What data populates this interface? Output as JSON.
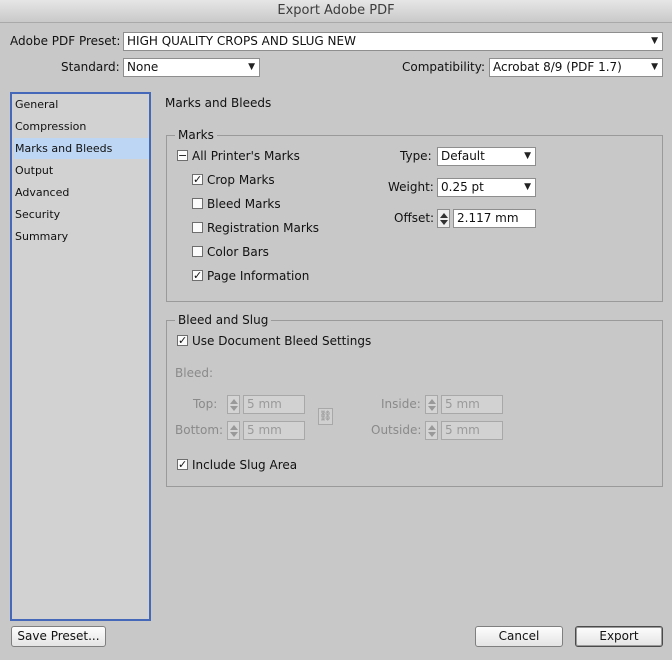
{
  "window": {
    "title": "Export Adobe PDF"
  },
  "header": {
    "preset_label": "Adobe PDF Preset:",
    "preset_value": "HIGH QUALITY CROPS AND SLUG NEW",
    "standard_label": "Standard:",
    "standard_value": "None",
    "compatibility_label": "Compatibility:",
    "compatibility_value": "Acrobat 8/9 (PDF 1.7)"
  },
  "sidebar": {
    "items": [
      {
        "label": "General"
      },
      {
        "label": "Compression"
      },
      {
        "label": "Marks and Bleeds"
      },
      {
        "label": "Output"
      },
      {
        "label": "Advanced"
      },
      {
        "label": "Security"
      },
      {
        "label": "Summary"
      }
    ],
    "selected": "Marks and Bleeds"
  },
  "main": {
    "section_title": "Marks and Bleeds",
    "marks": {
      "group_title": "Marks",
      "all_printers_marks": {
        "label": "All Printer's Marks",
        "state": "mixed"
      },
      "crop_marks": {
        "label": "Crop Marks",
        "checked": true
      },
      "bleed_marks": {
        "label": "Bleed Marks",
        "checked": false
      },
      "registration_marks": {
        "label": "Registration Marks",
        "checked": false
      },
      "color_bars": {
        "label": "Color Bars",
        "checked": false
      },
      "page_information": {
        "label": "Page Information",
        "checked": true
      },
      "type_label": "Type:",
      "type_value": "Default",
      "weight_label": "Weight:",
      "weight_value": "0.25 pt",
      "offset_label": "Offset:",
      "offset_value": "2.117 mm"
    },
    "bleed_slug": {
      "group_title": "Bleed and Slug",
      "use_doc_bleed": {
        "label": "Use Document Bleed Settings",
        "checked": true
      },
      "bleed_label": "Bleed:",
      "top_label": "Top:",
      "top_value": "5 mm",
      "bottom_label": "Bottom:",
      "bottom_value": "5 mm",
      "inside_label": "Inside:",
      "inside_value": "5 mm",
      "outside_label": "Outside:",
      "outside_value": "5 mm",
      "include_slug": {
        "label": "Include Slug Area",
        "checked": true
      }
    }
  },
  "footer": {
    "save_preset_label": "Save Preset...",
    "cancel_label": "Cancel",
    "export_label": "Export"
  },
  "glyphs": {
    "check": "✓",
    "mixed": "−",
    "arrow": "▼",
    "chain": "⛓"
  }
}
